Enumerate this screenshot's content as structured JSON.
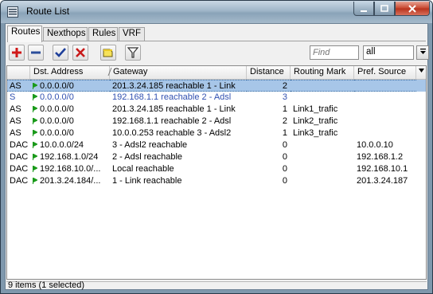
{
  "window": {
    "title": "Route List"
  },
  "tabs": [
    {
      "label": "Routes",
      "active": true
    },
    {
      "label": "Nexthops",
      "active": false
    },
    {
      "label": "Rules",
      "active": false
    },
    {
      "label": "VRF",
      "active": false
    }
  ],
  "toolbar": {
    "buttons": [
      {
        "name": "add-button",
        "icon": "plus-icon"
      },
      {
        "name": "remove-button",
        "icon": "minus-icon"
      },
      {
        "name": "enable-button",
        "icon": "check-icon"
      },
      {
        "name": "disable-button",
        "icon": "x-icon"
      },
      {
        "name": "comment-button",
        "icon": "note-icon"
      },
      {
        "name": "filter-button",
        "icon": "filter-icon"
      }
    ],
    "find_placeholder": "Find",
    "filter_value": "all"
  },
  "columns": [
    "",
    "Dst. Address",
    "Gateway",
    "Distance",
    "Routing Mark",
    "Pref. Source"
  ],
  "rows": [
    {
      "flags": "AS",
      "dst": "0.0.0.0/0",
      "gateway": "201.3.24.185 reachable 1 - Link",
      "distance": "2",
      "mark": "",
      "pref": "",
      "selected": true,
      "static": false
    },
    {
      "flags": "S",
      "dst": "0.0.0.0/0",
      "gateway": "192.168.1.1 reachable 2 - Adsl",
      "distance": "3",
      "mark": "",
      "pref": "",
      "selected": false,
      "static": true
    },
    {
      "flags": "AS",
      "dst": "0.0.0.0/0",
      "gateway": "201.3.24.185 reachable 1 - Link",
      "distance": "1",
      "mark": "Link1_trafic",
      "pref": "",
      "selected": false,
      "static": false
    },
    {
      "flags": "AS",
      "dst": "0.0.0.0/0",
      "gateway": "192.168.1.1 reachable 2 - Adsl",
      "distance": "2",
      "mark": "Link2_trafic",
      "pref": "",
      "selected": false,
      "static": false
    },
    {
      "flags": "AS",
      "dst": "0.0.0.0/0",
      "gateway": "10.0.0.253 reachable 3 - Adsl2",
      "distance": "1",
      "mark": "Link3_trafic",
      "pref": "",
      "selected": false,
      "static": false
    },
    {
      "flags": "DAC",
      "dst": "10.0.0.0/24",
      "gateway": "3 - Adsl2 reachable",
      "distance": "0",
      "mark": "",
      "pref": "10.0.0.10",
      "selected": false,
      "static": false
    },
    {
      "flags": "DAC",
      "dst": "192.168.1.0/24",
      "gateway": "2 - Adsl reachable",
      "distance": "0",
      "mark": "",
      "pref": "192.168.1.2",
      "selected": false,
      "static": false
    },
    {
      "flags": "DAC",
      "dst": "192.168.10.0/...",
      "gateway": "Local reachable",
      "distance": "0",
      "mark": "",
      "pref": "192.168.10.1",
      "selected": false,
      "static": false
    },
    {
      "flags": "DAC",
      "dst": "201.3.24.184/...",
      "gateway": "1 - Link reachable",
      "distance": "0",
      "mark": "",
      "pref": "201.3.24.187",
      "selected": false,
      "static": false
    }
  ],
  "status": {
    "text": "9 items (1 selected)"
  },
  "colors": {
    "selected_row": "#a7c6e8",
    "static_text": "#3050b0",
    "flag_green": "#1a9a1a"
  }
}
